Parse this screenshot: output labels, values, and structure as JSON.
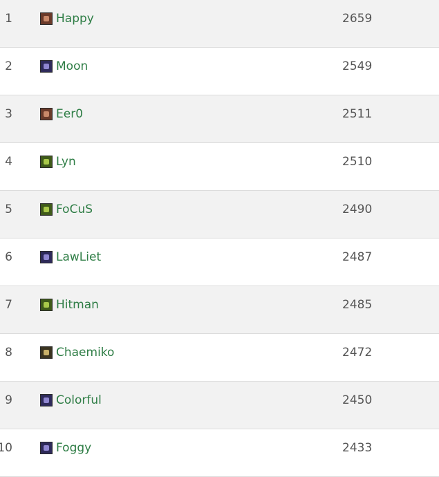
{
  "rankings": [
    {
      "rank": "1",
      "name": "Happy",
      "race_icon": "human-hero-icon",
      "score": "2659"
    },
    {
      "rank": "2",
      "name": "Moon",
      "race_icon": "undead-hero-icon",
      "score": "2549"
    },
    {
      "rank": "3",
      "name": "Eer0",
      "race_icon": "human-hero-icon",
      "score": "2511"
    },
    {
      "rank": "4",
      "name": "Lyn",
      "race_icon": "orc-hero-icon",
      "score": "2510"
    },
    {
      "rank": "5",
      "name": "FoCuS",
      "race_icon": "orc-hero-icon",
      "score": "2490"
    },
    {
      "rank": "6",
      "name": "LawLiet",
      "race_icon": "undead-hero-icon",
      "score": "2487"
    },
    {
      "rank": "7",
      "name": "Hitman",
      "race_icon": "orc-hero-icon",
      "score": "2485"
    },
    {
      "rank": "8",
      "name": "Chaemiko",
      "race_icon": "nightelf-hero-icon",
      "score": "2472"
    },
    {
      "rank": "9",
      "name": "Colorful",
      "race_icon": "undead-hero-icon",
      "score": "2450"
    },
    {
      "rank": "10",
      "name": "Foggy",
      "race_icon": "undead-hero-icon",
      "score": "2433"
    }
  ],
  "colors": {
    "link_green": "#2e7d45",
    "row_stripe": "#f2f2f2",
    "text_gray": "#555555"
  }
}
